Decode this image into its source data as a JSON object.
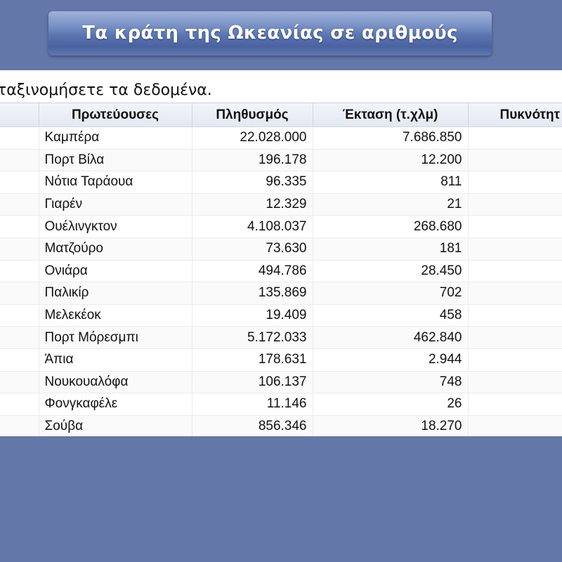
{
  "title": "Τα κράτη της Ωκεανίας σε αριθμούς",
  "instruction": "ταξινομήσετε τα δεδομένα.",
  "table": {
    "headers": {
      "first": "",
      "capital": "Πρωτεύουσες",
      "population": "Πληθυσμός",
      "area": "Έκταση (τ.χλμ)",
      "density": "Πυκνότητ"
    },
    "rows": [
      {
        "capital": "Καμπέρα",
        "population": "22.028.000",
        "area": "7.686.850",
        "density": ""
      },
      {
        "capital": "Πορτ Βίλα",
        "population": "196.178",
        "area": "12.200",
        "density": ""
      },
      {
        "capital": "Νότια Ταράουα",
        "population": "96.335",
        "area": "811",
        "density": ""
      },
      {
        "capital": "Γιαρέν",
        "population": "12.329",
        "area": "21",
        "density": ""
      },
      {
        "capital": "Ουέλινγκτον",
        "population": "4.108.037",
        "area": "268.680",
        "density": ""
      },
      {
        "capital": "Ματζούρο",
        "population": "73.630",
        "area": "181",
        "density": ""
      },
      {
        "capital": "Ονιάρα",
        "population": "494.786",
        "area": "28.450",
        "density": ""
      },
      {
        "capital": "Παλικίρ",
        "population": "135.869",
        "area": "702",
        "density": ""
      },
      {
        "capital": "Μελεκέοκ",
        "population": "19.409",
        "area": "458",
        "density": ""
      },
      {
        "capital": "Πορτ Μόρεσμπι",
        "population": "5.172.033",
        "area": "462.840",
        "density": ""
      },
      {
        "capital": "Άπια",
        "population": "178.631",
        "area": "2.944",
        "density": ""
      },
      {
        "capital": "Νουκουαλόφα",
        "population": "106.137",
        "area": "748",
        "density": ""
      },
      {
        "capital": "Φονγκαφέλε",
        "population": "11.146",
        "area": "26",
        "density": ""
      },
      {
        "capital": "Σούβα",
        "population": "856.346",
        "area": "18.270",
        "density": ""
      }
    ]
  },
  "colors": {
    "background": "#6377a9",
    "banner": "#5a74b0",
    "header": "#e3e8f2"
  }
}
